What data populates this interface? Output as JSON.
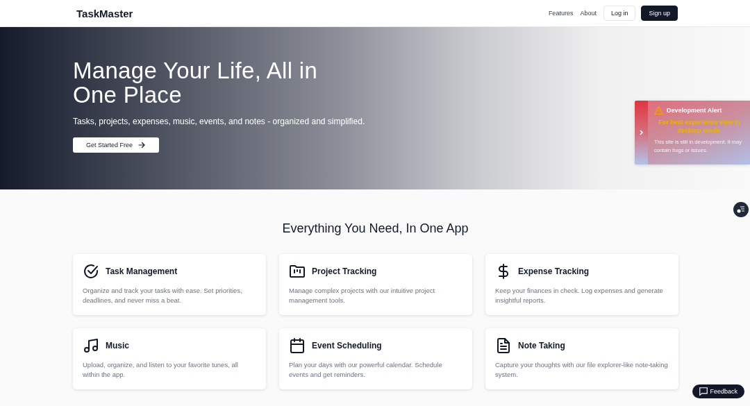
{
  "header": {
    "logo": "TaskMaster",
    "nav": [
      "Features",
      "About"
    ],
    "login": "Log in",
    "signup": "Sign up"
  },
  "hero": {
    "title": "Manage Your Life, All in One Place",
    "subtitle": "Tasks, projects, expenses, music, events, and notes - organized and simplified.",
    "cta": "Get Started Free"
  },
  "alert": {
    "title": "Development Alert",
    "highlight": "For best experience view in desktop mode.",
    "message": "This site is still in development. It may contain bugs or issues."
  },
  "features": {
    "title": "Everything You Need, In One App",
    "cards": [
      {
        "title": "Task Management",
        "text": "Organize and track your tasks with ease. Set priorities, deadlines, and never miss a beat."
      },
      {
        "title": "Project Tracking",
        "text": "Manage complex projects with our intuitive project management tools."
      },
      {
        "title": "Expense Tracking",
        "text": "Keep your finances in check. Log expenses and generate insightful reports."
      },
      {
        "title": "Music",
        "text": "Upload, organize, and listen to your favorite tunes, all within the app."
      },
      {
        "title": "Event Scheduling",
        "text": "Plan your days with our powerful calendar. Schedule events and get reminders."
      },
      {
        "title": "Note Taking",
        "text": "Capture your thoughts with our file explorer-like note-taking system."
      }
    ]
  },
  "feedback": "Feedback"
}
